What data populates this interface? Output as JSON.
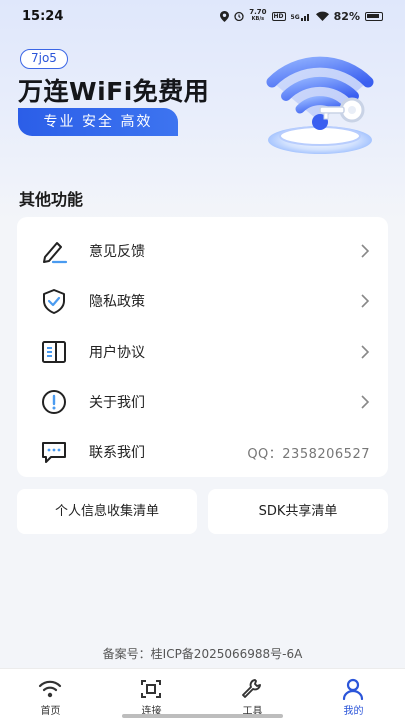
{
  "status_bar": {
    "time": "15:24",
    "speed_value": "7.70",
    "speed_unit": "KB/s",
    "hd": "HD",
    "network": "5G",
    "battery": "82%"
  },
  "banner": {
    "version": "7jo5",
    "title": "万连WiFi免费用",
    "slogan": "专业 安全 高效"
  },
  "section": {
    "title": "其他功能",
    "items": [
      {
        "label": "意见反馈",
        "icon": "edit-icon"
      },
      {
        "label": "隐私政策",
        "icon": "shield-check-icon"
      },
      {
        "label": "用户协议",
        "icon": "document-icon"
      },
      {
        "label": "关于我们",
        "icon": "info-icon"
      },
      {
        "label": "联系我们",
        "icon": "chat-icon",
        "value": "QQ：2358206527"
      }
    ]
  },
  "buttons": {
    "personal_info": "个人信息收集清单",
    "sdk": "SDK共享清单"
  },
  "icp": "备案号：桂ICP备2025066988号-6A",
  "tabs": [
    {
      "label": "首页",
      "icon": "wifi-icon"
    },
    {
      "label": "连接",
      "icon": "scan-icon"
    },
    {
      "label": "工具",
      "icon": "wrench-icon"
    },
    {
      "label": "我的",
      "icon": "user-icon",
      "active": true
    }
  ],
  "colors": {
    "accent": "#2b55d9",
    "icon_accent": "#4a9bf0"
  }
}
